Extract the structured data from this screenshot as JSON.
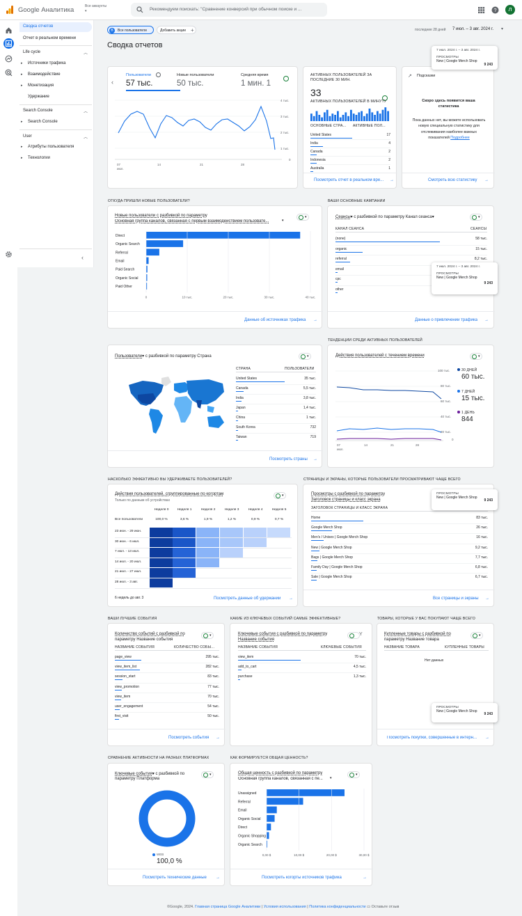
{
  "app": {
    "name": "Google Аналитика",
    "accounts": "Все аккаунты",
    "search_placeholder": "Рекомендуем поискать: \"Сравнение конверсий при обычном поиске и ...",
    "avatar": "Л"
  },
  "nav": {
    "overview": "Сводка отчетов",
    "realtime": "Отчет в реальном времени",
    "lifecycle": "Life cycle",
    "traffic": "Источники трафика",
    "engagement": "Взаимодействие",
    "monetization": "Монетизация",
    "retention": "Удержание",
    "sc_section": "Search Console",
    "sc_item": "Search Console",
    "user": "User",
    "attrs": "Атрибуты пользователя",
    "tech": "Технологии"
  },
  "filters": {
    "chip": "Все пользователи",
    "add": "Добавить акции",
    "range_label": "последние 28 дней",
    "range": "7 июл. – 3 авг. 2024 г."
  },
  "page_title": "Сводка отчетов",
  "tooltip": {
    "date": "7 июл. 2024 г. – 3 авг. 2024 г.",
    "key": "ПРОСМОТРЫ",
    "name": "New | Google Merch Shop",
    "value": "9 243"
  },
  "kpi": {
    "m1_label": "Пользователи",
    "m1_value": "57 тыс.",
    "m2_label": "Новые пользователи",
    "m2_value": "50 тыс.",
    "m3_label": "Средняя время",
    "m3_value": "1 мин. 1",
    "y_ticks": [
      "4 тыс.",
      "3 тыс.",
      "2 тыс.",
      "1 тыс.",
      "0"
    ],
    "x_ticks": [
      "07",
      "14",
      "21",
      "28"
    ],
    "x_sub": "июл."
  },
  "realtime": {
    "title": "АКТИВНЫХ ПОЛЬЗОВАТЕЛЕЙ ЗА ПОСЛЕДНИЕ 30 МИН.",
    "value": "33",
    "per_min": "АКТИВНЫХ ПОЛЬЗОВАТЕЛЕЙ В МИНУТУ",
    "col1": "ОСНОВНЫЕ СТРА...",
    "col2": "АКТИВНЫЕ ПОЛ...",
    "rows": [
      {
        "k": "United States",
        "v": "17"
      },
      {
        "k": "India",
        "v": "4"
      },
      {
        "k": "Canada",
        "v": "2"
      },
      {
        "k": "Indonesia",
        "v": "2"
      },
      {
        "k": "Australia",
        "v": "1"
      }
    ],
    "link": "Посмотреть отчет в реальном вре..."
  },
  "insights": {
    "title": "Подсказки",
    "heading": "Скоро здесь появится ваша статистика",
    "body": "Пока данных нет, вы можете использовать новую специальную статистику для отслеживания наиболее важных показателей",
    "more": "Подробнее",
    "link": "Смотреть всю статистику"
  },
  "sections": {
    "s1": "ОТКУДА ПРИШЛИ НОВЫЕ ПОЛЬЗОВАТЕЛИ?",
    "s2": "ВАШИ ОСНОВНЫЕ КАМПАНИИ",
    "s3": "ТЕНДЕНЦИИ СРЕДИ АКТИВНЫХ ПОЛЬЗОВАТЕЛЕЙ",
    "s4": "НАСКОЛЬКО ЭФФЕКТИВНО ВЫ УДЕРЖИВАЕТЕ ПОЛЬЗОВАТЕЛЕЙ?",
    "s5": "СТРАНИЦЫ И ЭКРАНЫ, КОТОРЫЕ ПОЛЬЗОВАТЕЛИ ПРОСМАТРИВАЮТ ЧАЩЕ ВСЕГО",
    "s6": "ВАШИ ЛУЧШИЕ СОБЫТИЯ",
    "s7": "КАКИЕ ИЗ КЛЮЧЕВЫХ СОБЫТИЙ САМЫЕ ЭФФЕКТИВНЫЕ?",
    "s8": "ТОВАРЫ, КОТОРЫЕ У ВАС ПОКУПАЮТ ЧАЩЕ ВСЕГО",
    "s9": "СРАВНЕНИЕ АКТИВНОСТИ НА РАЗНЫХ ПЛАТФОРМАХ",
    "s10": "КАК ФОРМИРУЕТСЯ ОБЩАЯ ЦЕННОСТЬ?"
  },
  "acq": {
    "title1": "Новые пользователи с разбивкой по параметру",
    "title2": "Основная группа каналов, связанная с первым взаимодействием пользовате...",
    "categories": [
      "Direct",
      "Organic Search",
      "Referral",
      "Email",
      "Paid Search",
      "Organic Social",
      "Paid Other"
    ],
    "values": [
      37500,
      9000,
      3200,
      600,
      300,
      250,
      200
    ],
    "x_ticks": [
      "0",
      "10 тыс.",
      "20 тыс.",
      "30 тыс.",
      "40 тыс."
    ],
    "link": "Данные об источниках трафика"
  },
  "campaigns": {
    "title": "Сеансы",
    "title_rest": " с разбивкой по параметру Канал сеанса",
    "col1": "КАНАЛ СЕАНСА",
    "col2": "СЕАНСЫ",
    "rows": [
      {
        "k": "(none)",
        "v": "58 тыс.",
        "f": 1
      },
      {
        "k": "organic",
        "v": "15 тыс.",
        "f": 0.26
      },
      {
        "k": "referral",
        "v": "8,2 тыс.",
        "f": 0.14
      },
      {
        "k": "email",
        "v": "",
        "f": 0.02
      },
      {
        "k": "cpc",
        "v": "",
        "f": 0.01
      },
      {
        "k": "other",
        "v": "",
        "f": 0.01
      }
    ],
    "link": "Данные о привлечении трафика"
  },
  "country": {
    "title": "Пользователи",
    "title_rest": " с разбивкой по параметру Страна",
    "col1": "СТРАНА",
    "col2": "ПОЛЬЗОВАТЕЛИ",
    "rows": [
      {
        "k": "United States",
        "v": "35 тыс.",
        "f": 1
      },
      {
        "k": "Canada",
        "v": "5,5 тыс.",
        "f": 0.16
      },
      {
        "k": "India",
        "v": "3,8 тыс.",
        "f": 0.11
      },
      {
        "k": "Japan",
        "v": "1,4 тыс.",
        "f": 0.04
      },
      {
        "k": "China",
        "v": "1 тыс.",
        "f": 0.03
      },
      {
        "k": "South Korea",
        "v": "732",
        "f": 0.02
      },
      {
        "k": "Taiwan",
        "v": "719",
        "f": 0.02
      }
    ],
    "link": "Посмотреть страны"
  },
  "trend": {
    "title": "Действия пользователей с течением времени",
    "y_ticks": [
      "100 тыс.",
      "80 тыс.",
      "60 тыс.",
      "40 тыс.",
      "20 тыс.",
      "0"
    ],
    "x_ticks": [
      "07",
      "14",
      "21",
      "28"
    ],
    "x_sub": "июл.",
    "l1": "30 ДНЕЙ",
    "v1": "60 тыс.",
    "l2": "7 ДНЕЙ",
    "v2": "15 тыс.",
    "l3": "1 ДЕНЬ",
    "v3": "844"
  },
  "cohort": {
    "title": "Действия пользователей, сгруппированные по когортам",
    "sub": "Только по данным об устройствах",
    "cols": [
      "Неделя 0",
      "Неделя 1",
      "Неделя 2",
      "Неделя 3",
      "Неделя 4",
      "Неделя 5"
    ],
    "all_label": "Все пользователи",
    "all_vals": [
      "100,0 %",
      "3,6 %",
      "1,9 %",
      "1,2 %",
      "0,9 %",
      "0,7 %"
    ],
    "rows": [
      "23 июн. - 29 июн.",
      "30 июн. - 6 июл.",
      "7 июл. - 13 июл.",
      "14 июл. - 20 июл.",
      "21 июл. - 27 июл.",
      "28 июл. - 3 авг."
    ],
    "footer": "6 недель до авг. 3",
    "link": "Посмотреть данные об удержании"
  },
  "pages": {
    "title1": "Просмотры с разбивкой по параметру",
    "title2": "Заголовок страницы и класс экрана",
    "col": "ЗАГОЛОВОК СТРАНИЦЫ И КЛАСС ЭКРАНА",
    "rows": [
      {
        "k": "Home",
        "v": "83 тыс.",
        "f": 0.5
      },
      {
        "k": "Google Merch Shop",
        "v": "26 тыс.",
        "f": 0.2
      },
      {
        "k": "Men's / Unisex | Google Merch Shop",
        "v": "16 тыс.",
        "f": 0.12
      },
      {
        "k": "New | Google Merch Shop",
        "v": "9,2 тыс.",
        "f": 0.08
      },
      {
        "k": "Bags | Google Merch Shop",
        "v": "7,7 тыс.",
        "f": 0.06
      },
      {
        "k": "Family Day | Google Merch Shop",
        "v": "6,8 тыс.",
        "f": 0.05
      },
      {
        "k": "Sale | Google Merch Shop",
        "v": "6,7 тыс.",
        "f": 0.05
      }
    ],
    "link": "Все страницы и экраны"
  },
  "events": {
    "title1": "Количество событий с разбивкой по",
    "title2": "параметру Название события",
    "col1": "НАЗВАНИЕ СОБЫТИЯ",
    "col2": "КОЛИЧЕСТВО СОБЫ...",
    "rows": [
      {
        "k": "page_view",
        "v": "295 тыс.",
        "f": 1
      },
      {
        "k": "view_item_list",
        "v": "282 тыс.",
        "f": 0.95
      },
      {
        "k": "session_start",
        "v": "83 тыс.",
        "f": 0.28
      },
      {
        "k": "view_promotion",
        "v": "77 тыс.",
        "f": 0.26
      },
      {
        "k": "view_item",
        "v": "70 тыс.",
        "f": 0.24
      },
      {
        "k": "user_engagement",
        "v": "54 тыс.",
        "f": 0.18
      },
      {
        "k": "first_visit",
        "v": "50 тыс.",
        "f": 0.17
      }
    ],
    "link": "Посмотреть события"
  },
  "keyevents": {
    "title1": "Ключевые события с разбивкой по параметру",
    "title2": "Название события",
    "col1": "НАЗВАНИЕ СОБЫТИЯ",
    "col2": "КЛЮЧЕВЫЕ СОБЫТИЯ",
    "rows": [
      {
        "k": "view_item",
        "v": "70 тыс.",
        "f": 1
      },
      {
        "k": "add_to_cart",
        "v": "4,5 тыс.",
        "f": 0.06
      },
      {
        "k": "purchase",
        "v": "1,3 тыс.",
        "f": 0.02
      }
    ]
  },
  "items": {
    "title1": "Купленные товары с разбивкой по",
    "title2": "параметру Название товара",
    "col1": "НАЗВАНИЕ ТОВАРА",
    "col2": "КУПЛЕННЫЕ ТОВАРЫ",
    "empty": "Нет данных",
    "link": "Посмотреть покупки, совершенные в интерн..."
  },
  "platform": {
    "title1": "Ключевые события",
    "title2": " с разбивкой по",
    "title3": "параметру Платформа",
    "legend": "WEB",
    "value": "100,0 %",
    "link": "Посмотреть технические данные"
  },
  "ltv": {
    "title1": "Общая ценность с разбивкой по параметру",
    "title2": "Основная группа каналов, связанная с пе...",
    "categories": [
      "Unassigned",
      "Referral",
      "Email",
      "Organic Social",
      "Direct",
      "Organic Shopping",
      "Organic Search"
    ],
    "values": [
      32000,
      15000,
      4200,
      3300,
      1800,
      1000,
      300
    ],
    "x_ticks": [
      "0,00 $",
      "10,00 $",
      "20,00 $",
      "30,00 $"
    ],
    "link": "Посмотреть когорты источников трафика"
  },
  "footer": {
    "copy": "©Google, 2024.",
    "l1": "Главная страница Google Аналитики",
    "l2": "Условия использования",
    "l3": "Политика конфиденциальности",
    "fb": "Оставьте отзыв"
  },
  "colors": {
    "accent": "#1a73e8",
    "dark": "#0d47a1",
    "green": "#137333"
  }
}
